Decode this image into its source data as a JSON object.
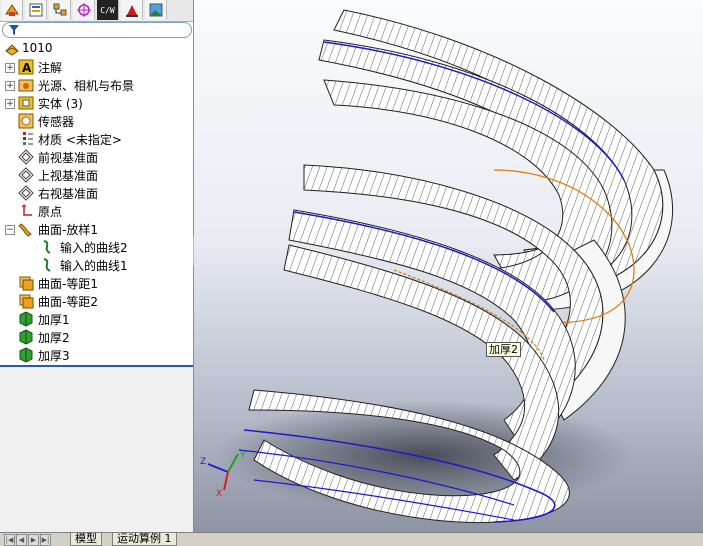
{
  "tree": {
    "root": "1010",
    "items": [
      {
        "label": "注解",
        "icon": "annotation-icon",
        "expandable": true
      },
      {
        "label": "光源、相机与布景",
        "icon": "lights-cameras-icon",
        "expandable": true
      },
      {
        "label": "实体 (3)",
        "icon": "solid-bodies-icon",
        "expandable": true
      },
      {
        "label": "传感器",
        "icon": "sensor-icon",
        "expandable": false
      },
      {
        "label": "材质 <未指定>",
        "icon": "material-icon",
        "expandable": false
      },
      {
        "label": "前视基准面",
        "icon": "plane-icon",
        "expandable": false
      },
      {
        "label": "上视基准面",
        "icon": "plane-icon",
        "expandable": false
      },
      {
        "label": "右视基准面",
        "icon": "plane-icon",
        "expandable": false
      },
      {
        "label": "原点",
        "icon": "origin-icon",
        "expandable": false
      },
      {
        "label": "曲面-放样1",
        "icon": "surface-loft-icon",
        "expandable": true,
        "expanded": true
      },
      {
        "label": "输入的曲线2",
        "icon": "curve-icon",
        "child": true
      },
      {
        "label": "输入的曲线1",
        "icon": "curve-icon",
        "child": true
      },
      {
        "label": "曲面-等距1",
        "icon": "surface-offset-icon",
        "expandable": false
      },
      {
        "label": "曲面-等距2",
        "icon": "surface-offset-icon",
        "expandable": false
      },
      {
        "label": "加厚1",
        "icon": "thicken-icon",
        "expandable": false
      },
      {
        "label": "加厚2",
        "icon": "thicken-icon",
        "expandable": false
      },
      {
        "label": "加厚3",
        "icon": "thicken-icon",
        "expandable": false
      }
    ]
  },
  "toolbar": {
    "buttons": [
      "feature-manager-icon",
      "property-manager-icon",
      "configuration-manager-icon",
      "dimxpert-icon",
      "cam-icon",
      "display-manager-icon",
      "appearance-icon"
    ],
    "cam_label": "C/W"
  },
  "viewport": {
    "tooltip": "加厚2",
    "triad": {
      "z_label": "Z",
      "y_label": "Y",
      "x_label": "X"
    }
  },
  "tabs": {
    "model": "模型",
    "motion": "运动算例 1"
  },
  "colors": {
    "selection": "#2a5caa",
    "edge_blue": "#1a1acc",
    "edge_orange": "#e07800"
  }
}
